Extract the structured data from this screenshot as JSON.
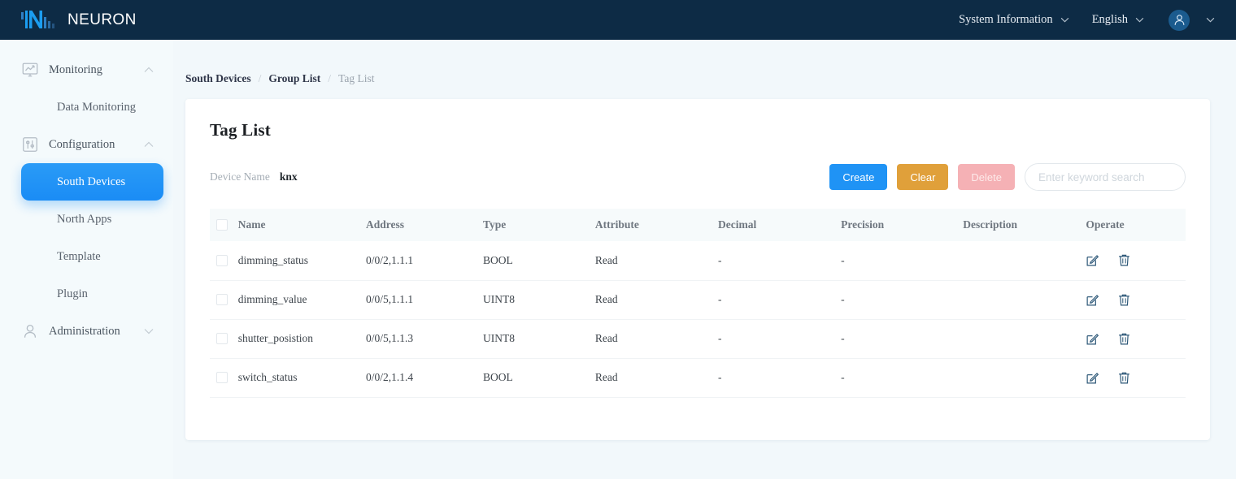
{
  "topbar": {
    "brand": "NEURON",
    "system_info": "System Information",
    "language": "English"
  },
  "sidebar": {
    "items": [
      {
        "label": "Monitoring",
        "icon": "monitor-icon",
        "type": "group",
        "expanded": true
      },
      {
        "label": "Data Monitoring",
        "icon": "",
        "type": "sub",
        "active": false
      },
      {
        "label": "Configuration",
        "icon": "sliders-icon",
        "type": "group",
        "expanded": true
      },
      {
        "label": "South Devices",
        "icon": "",
        "type": "sub",
        "active": true
      },
      {
        "label": "North Apps",
        "icon": "",
        "type": "sub",
        "active": false
      },
      {
        "label": "Template",
        "icon": "",
        "type": "sub",
        "active": false
      },
      {
        "label": "Plugin",
        "icon": "",
        "type": "sub",
        "active": false
      },
      {
        "label": "Administration",
        "icon": "user-icon",
        "type": "group",
        "expanded": false
      }
    ]
  },
  "breadcrumb": {
    "items": [
      "South Devices",
      "Group List",
      "Tag List"
    ],
    "separator": "/"
  },
  "page": {
    "title": "Tag List",
    "device_name_label": "Device Name",
    "device_name_value": "knx"
  },
  "toolbar": {
    "create_label": "Create",
    "clear_label": "Clear",
    "delete_label": "Delete",
    "search_placeholder": "Enter keyword search",
    "search_value": ""
  },
  "table": {
    "columns": [
      "Name",
      "Address",
      "Type",
      "Attribute",
      "Decimal",
      "Precision",
      "Description",
      "Operate"
    ],
    "rows": [
      {
        "name": "dimming_status",
        "address": "0/0/2,1.1.1",
        "type": "BOOL",
        "attribute": "Read",
        "decimal": "-",
        "precision": "-",
        "description": ""
      },
      {
        "name": "dimming_value",
        "address": "0/0/5,1.1.1",
        "type": "UINT8",
        "attribute": "Read",
        "decimal": "-",
        "precision": "-",
        "description": ""
      },
      {
        "name": "shutter_posistion",
        "address": "0/0/5,1.1.3",
        "type": "UINT8",
        "attribute": "Read",
        "decimal": "-",
        "precision": "-",
        "description": ""
      },
      {
        "name": "switch_status",
        "address": "0/0/2,1.1.4",
        "type": "BOOL",
        "attribute": "Read",
        "decimal": "-",
        "precision": "-",
        "description": ""
      }
    ]
  },
  "colors": {
    "header_bg": "#0d2b45",
    "accent_blue": "#1f93f5",
    "warning_orange": "#e0a03a",
    "danger_disabled": "#f5b1b5",
    "page_bg": "#f2f8fb",
    "icon_navy": "#2c5777"
  }
}
